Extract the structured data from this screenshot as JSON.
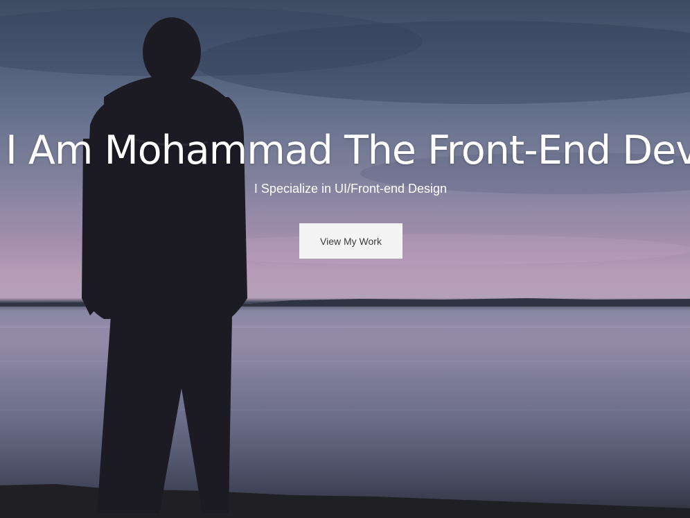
{
  "hero": {
    "headline": "I Am Mohammad The Front-End Develop",
    "tagline": "I Specialize in UI/Front-end Design",
    "cta_label": "View My Work"
  }
}
